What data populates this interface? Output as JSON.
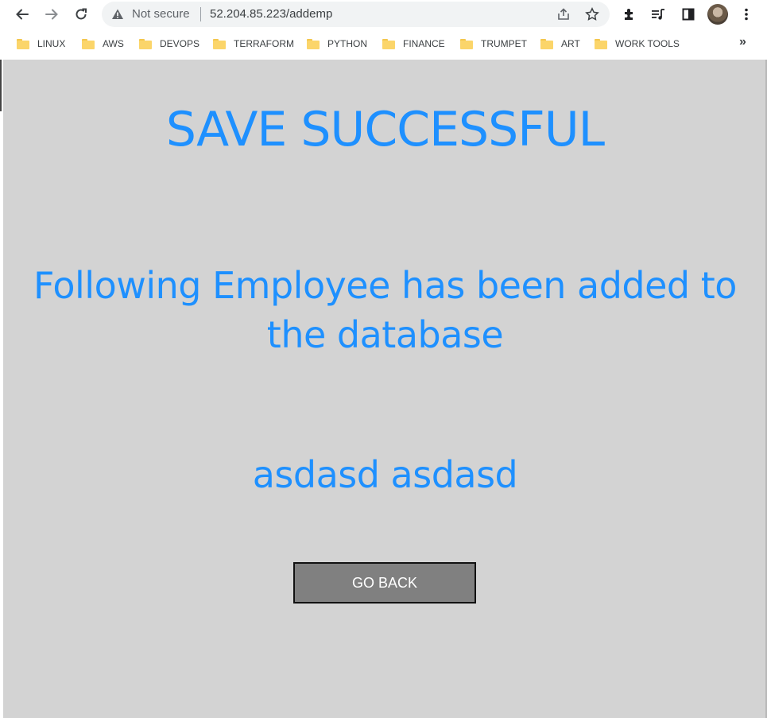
{
  "browser": {
    "security_label": "Not secure",
    "url": "52.204.85.223/addemp"
  },
  "bookmarks": [
    {
      "label": "LINUX"
    },
    {
      "label": "AWS"
    },
    {
      "label": "DEVOPS"
    },
    {
      "label": "TERRAFORM"
    },
    {
      "label": "PYTHON"
    },
    {
      "label": "FINANCE"
    },
    {
      "label": "TRUMPET"
    },
    {
      "label": "ART"
    },
    {
      "label": "WORK TOOLS"
    }
  ],
  "bookmarks_overflow": "»",
  "page": {
    "title": "SAVE SUCCESSFUL",
    "message_line1": "Following Employee has been added to",
    "message_line2": "the database",
    "employee_name": "asdasd asdasd",
    "go_back_label": "GO BACK"
  },
  "colors": {
    "heading": "#1e90ff",
    "page_background": "#d3d3d3",
    "button_background": "#808080"
  }
}
